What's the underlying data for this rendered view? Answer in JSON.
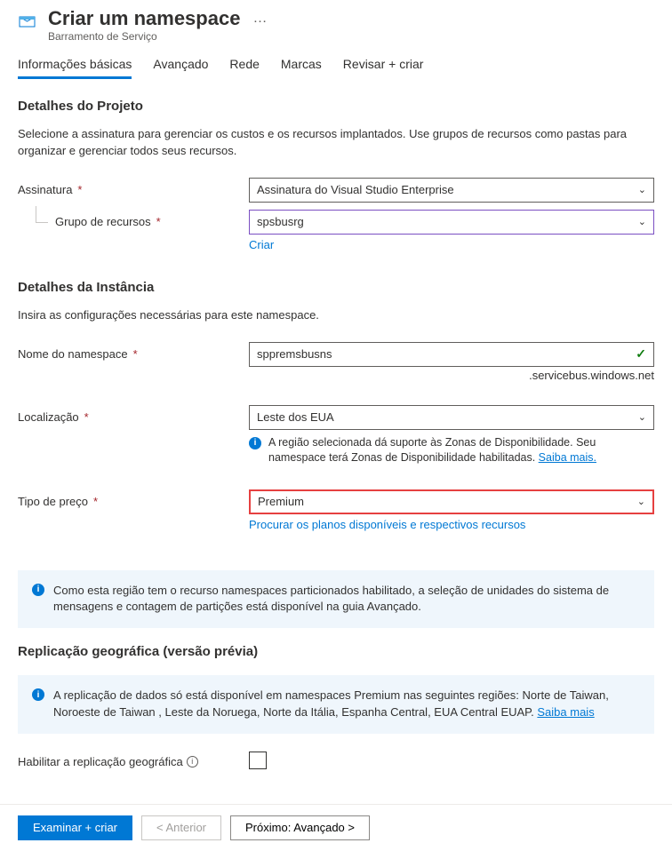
{
  "header": {
    "title": "Criar um namespace",
    "subtitle": "Barramento de Serviço",
    "ellipsis": "…"
  },
  "tabs": [
    "Informações básicas",
    "Avançado",
    "Rede",
    "Marcas",
    "Revisar + criar"
  ],
  "project": {
    "heading": "Detalhes do Projeto",
    "desc": "Selecione a assinatura para gerenciar os custos e os recursos implantados. Use grupos de recursos como pastas para organizar e gerenciar todos seus recursos.",
    "subscription": {
      "label": "Assinatura",
      "value": "Assinatura do Visual Studio Enterprise"
    },
    "resourceGroup": {
      "label": "Grupo de recursos",
      "value": "spsbusrg",
      "newLink": "Criar"
    }
  },
  "instance": {
    "heading": "Detalhes da Instância",
    "desc": "Insira as configurações necessárias para este namespace.",
    "name": {
      "label": "Nome do namespace",
      "value": "sppremsbusns",
      "suffix": ".servicebus.windows.net"
    },
    "location": {
      "label": "Localização",
      "value": "Leste dos EUA",
      "info": "A região selecionada dá suporte às Zonas de Disponibilidade. Seu namespace terá Zonas de Disponibilidade habilitadas. ",
      "learnMore": "Saiba mais."
    },
    "pricing": {
      "label": "Tipo de preço",
      "value": "Premium",
      "browseLink": "Procurar os planos disponíveis e respectivos recursos"
    }
  },
  "partitionPanel": "Como esta região tem o recurso namespaces particionados habilitado, a seleção de unidades do sistema de mensagens e contagem de partições está disponível na guia Avançado.",
  "geo": {
    "heading": "Replicação geográfica (versão prévia)",
    "panel": "A replicação de dados só está disponível em namespaces Premium nas seguintes regiões: Norte de Taiwan, Noroeste de Taiwan , Leste da Noruega, Norte da Itália, Espanha Central, EUA Central EUAP. ",
    "learnMore": "Saiba mais",
    "enableLabel": "Habilitar a replicação geográfica"
  },
  "footer": {
    "review": "Examinar + criar",
    "prev": "< Anterior",
    "next": "Próximo: Avançado >"
  }
}
